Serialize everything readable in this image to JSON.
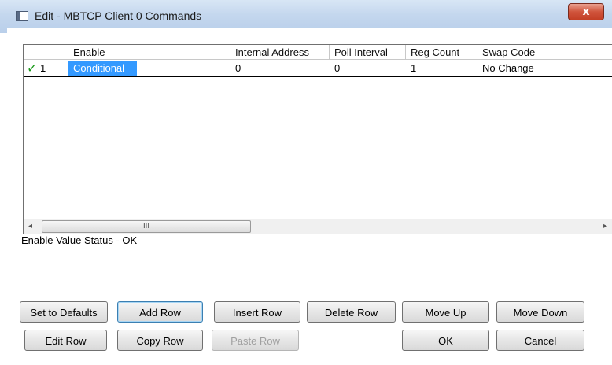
{
  "window": {
    "title": "Edit - MBTCP Client 0 Commands",
    "close_label": "x"
  },
  "grid": {
    "columns": [
      "Enable",
      "Internal Address",
      "Poll Interval",
      "Reg Count",
      "Swap Code"
    ],
    "rows": [
      {
        "number": "1",
        "enable": "Conditional",
        "internal_address": "0",
        "poll_interval": "0",
        "reg_count": "1",
        "swap_code": "No Change"
      }
    ],
    "scroll_left": "◂",
    "scroll_right": "▸",
    "thumb_grip": "III"
  },
  "status_text": "Enable Value Status - OK",
  "buttons": {
    "set_defaults": "Set to Defaults",
    "add_row": "Add Row",
    "insert_row": "Insert Row",
    "delete_row": "Delete Row",
    "move_up": "Move Up",
    "move_down": "Move Down",
    "edit_row": "Edit Row",
    "copy_row": "Copy Row",
    "paste_row": "Paste Row",
    "ok": "OK",
    "cancel": "Cancel"
  },
  "icons": {
    "check": "check-icon",
    "window": "window-icon",
    "close": "close-icon"
  },
  "colors": {
    "selection": "#3399ff",
    "check": "#1a9a1a",
    "close_button": "#c9472e"
  }
}
